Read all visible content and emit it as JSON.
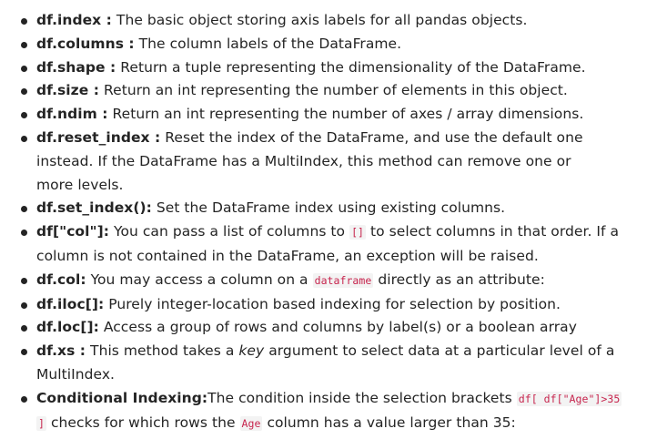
{
  "items": [
    {
      "term": "df.index :",
      "lines": [
        "The basic object storing axis labels for all pandas objects."
      ]
    },
    {
      "term": "df.columns :",
      "lines": [
        "The column labels of the DataFrame."
      ]
    },
    {
      "term": "df.shape :",
      "lines": [
        "Return a tuple representing the dimensionality of the DataFrame."
      ]
    },
    {
      "term": "df.size :",
      "lines": [
        "Return an int representing the number of elements in this object."
      ]
    },
    {
      "term": "df.ndim :",
      "lines": [
        "Return an int representing the number of axes / array dimensions."
      ]
    },
    {
      "term": "df.reset_index :",
      "lines": [
        "Reset the index of the DataFrame, and use the default one",
        "instead. If the DataFrame has a MultiIndex, this method can remove one or",
        "more levels."
      ]
    },
    {
      "term": "df.set_index():",
      "lines": [
        "Set the DataFrame index using existing columns."
      ]
    },
    {
      "term": "df[\"col\"]:",
      "line1_before": "You can pass a list of columns to",
      "line1_code": "[]",
      "line1_after": "to select columns in that order. If a",
      "line2": "column is not contained in the DataFrame, an exception will be raised."
    },
    {
      "term": "df.col:",
      "before": "You may access a column on a",
      "code": "dataframe",
      "after": "directly as an attribute:"
    },
    {
      "term": "df.iloc[]:",
      "lines": [
        "Purely integer-location based indexing for selection by position."
      ]
    },
    {
      "term": "df.loc[]:",
      "lines": [
        "Access a group of rows and columns by label(s) or a boolean array"
      ]
    },
    {
      "term": "df.xs :",
      "line1_before": "This method takes a",
      "line1_em": "key",
      "line1_after": "argument to select data at a particular level of a",
      "line2": "MultiIndex."
    },
    {
      "term": "Conditional Indexing:",
      "line1_text": "The condition inside the selection brackets",
      "line1_code": "df[ df[\"Age\"]>35",
      "line2_code": "]",
      "line2_before": "checks for which rows the",
      "line2_code2": "Age",
      "line2_after": "column has a value larger than 35:"
    }
  ]
}
